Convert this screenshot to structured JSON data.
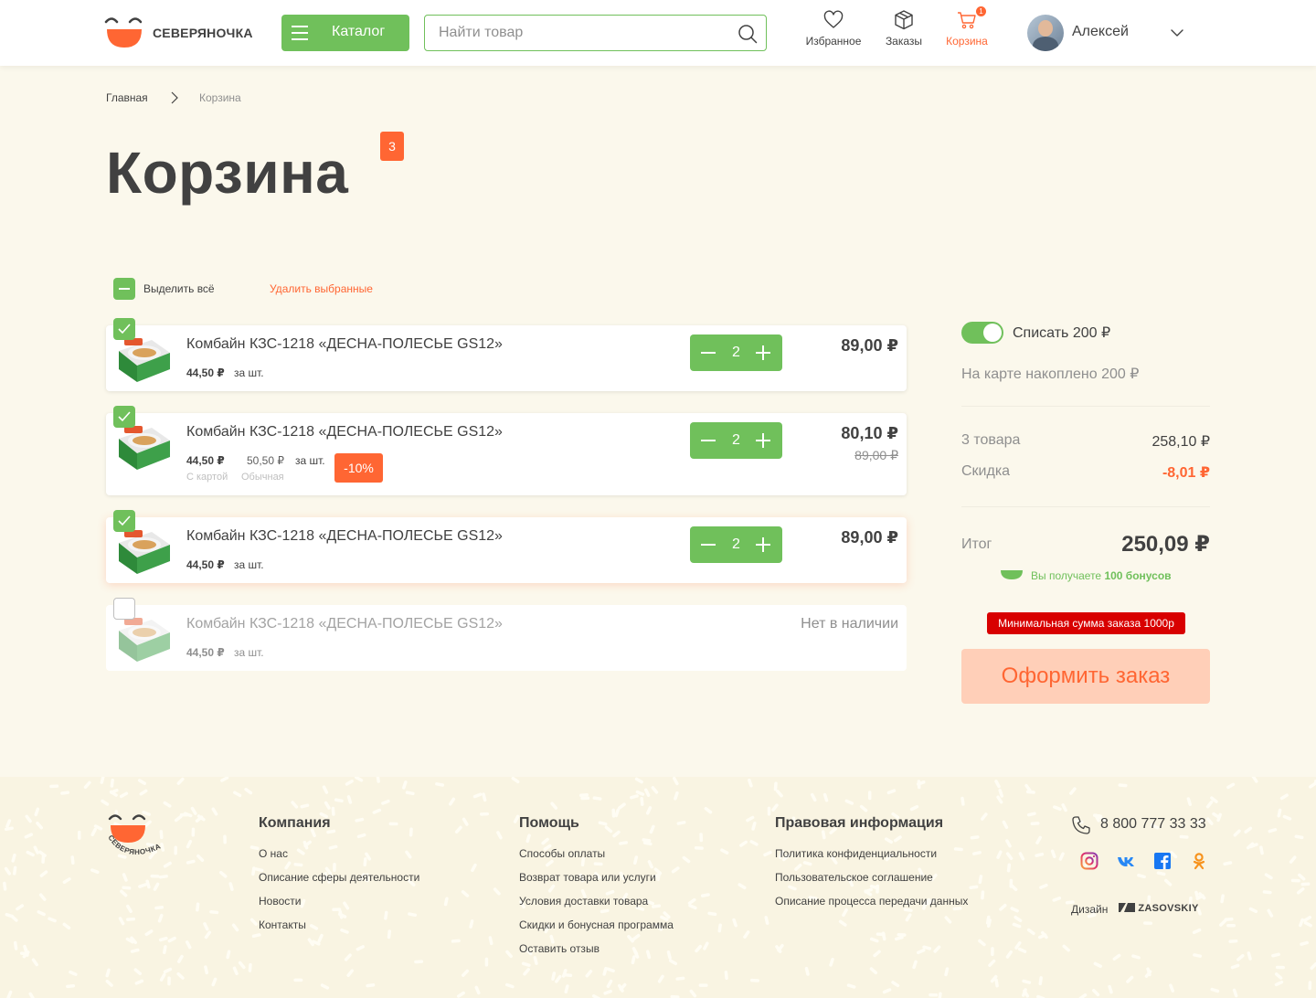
{
  "header": {
    "logo_text": "СЕВЕРЯНОЧКА",
    "catalog_label": "Каталог",
    "search_placeholder": "Найти товар",
    "nav": {
      "favorites": "Избранное",
      "orders": "Заказы",
      "cart": "Корзина",
      "cart_count": "1"
    },
    "user_name": "Алексей"
  },
  "breadcrumb": {
    "home": "Главная",
    "current": "Корзина"
  },
  "page": {
    "title": "Корзина",
    "count_badge": "3"
  },
  "toolbar": {
    "select_all": "Выделить всё",
    "delete_selected": "Удалить выбранные"
  },
  "items": [
    {
      "title": "Комбайн КЗС-1218 «ДЕСНА-ПОЛЕСЬЕ GS12»",
      "unit_price": "44,50 ₽",
      "per": "за шт.",
      "qty": "2",
      "total": "89,00 ₽",
      "checked": true
    },
    {
      "title": "Комбайн КЗС-1218 «ДЕСНА-ПОЛЕСЬЕ GS12»",
      "unit_price": "44,50 ₽",
      "ordinary_price": "50,50 ₽",
      "per": "за шт.",
      "card_label": "С картой",
      "ordinary_label": "Обычная",
      "discount": "-10%",
      "qty": "2",
      "total": "80,10 ₽",
      "old_total": "89,00 ₽",
      "checked": true
    },
    {
      "title": "Комбайн КЗС-1218 «ДЕСНА-ПОЛЕСЬЕ GS12»",
      "unit_price": "44,50 ₽",
      "per": "за шт.",
      "qty": "2",
      "total": "89,00 ₽",
      "checked": true
    },
    {
      "title": "Комбайн КЗС-1218 «ДЕСНА-ПОЛЕСЬЕ GS12»",
      "unit_price": "44,50 ₽",
      "per": "за шт.",
      "status": "Нет в наличии",
      "checked": false
    }
  ],
  "summary": {
    "bonus_toggle": "Списать 200 ₽",
    "accumulated": "На карте накоплено 200 ₽",
    "items_label": "3 товара",
    "items_sum": "258,10  ₽",
    "discount_label": "Скидка",
    "discount_value": "-8,01 ₽",
    "total_label": "Итог",
    "total_value": "250,09 ₽",
    "bonus_prefix": "Вы получаете ",
    "bonus_amount": "100 бонусов",
    "min_order": "Минимальная сумма заказа 1000р",
    "checkout": "Оформить заказ"
  },
  "footer": {
    "logo_text": "СЕВЕРЯНОЧКА",
    "company": {
      "title": "Компания",
      "links": [
        "О нас",
        "Описание сферы деятельности",
        "Новости",
        "Контакты"
      ]
    },
    "help": {
      "title": "Помощь",
      "links": [
        "Способы оплаты",
        "Возврат товара или услуги",
        "Условия доставки товара",
        "Скидки и бонусная программа",
        "Оставить отзыв"
      ]
    },
    "legal": {
      "title": "Правовая информация",
      "links": [
        "Политика конфиденциальности",
        "Пользовательское соглашение",
        "Описание процесса передачи данных"
      ]
    },
    "phone": "8 800 777 33 33",
    "socials": [
      "instagram-icon",
      "vk-icon",
      "facebook-icon",
      "odnoklassniki-icon"
    ],
    "design_label": "Дизайн",
    "design_brand": "ZASOVSKIY"
  },
  "colors": {
    "primary_green": "#70c05b",
    "accent_orange": "#ff6633",
    "background": "#fbf8ec",
    "text": "#414141",
    "alert_red": "#d80000"
  }
}
